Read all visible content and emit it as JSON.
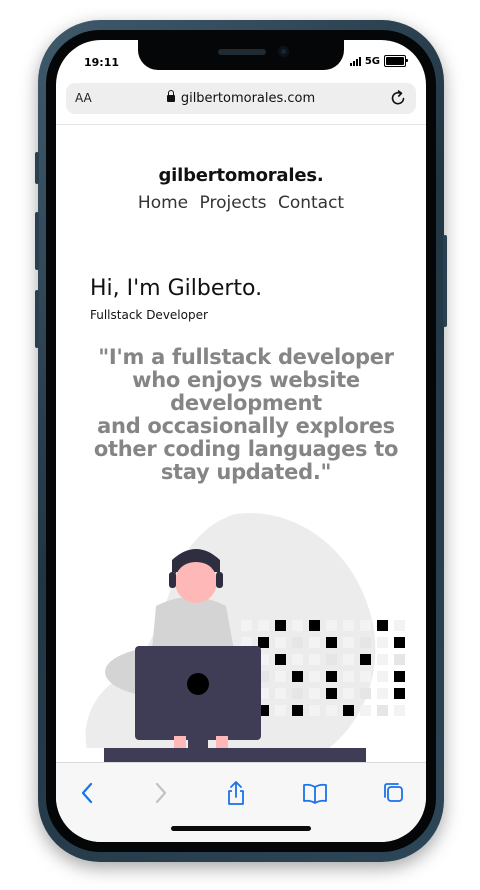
{
  "status": {
    "time": "19:11",
    "network": "5G"
  },
  "browser": {
    "text_size_label": "AA",
    "url": "gilbertomorales.com"
  },
  "site": {
    "brand": "gilbertomorales.",
    "nav": [
      "Home",
      "Projects",
      "Contact"
    ],
    "greeting": "Hi, I'm Gilberto.",
    "role": "Fullstack Developer",
    "quote_lines": [
      "\"I'm a fullstack developer",
      "who enjoys website",
      "development",
      "and occasionally explores",
      "other coding languages to",
      "stay updated.\""
    ]
  },
  "colors": {
    "accent_blue": "#1a73e8",
    "quote_gray": "#858585",
    "illustration_dark": "#3f3d56",
    "skin": "#ffb8b8"
  }
}
